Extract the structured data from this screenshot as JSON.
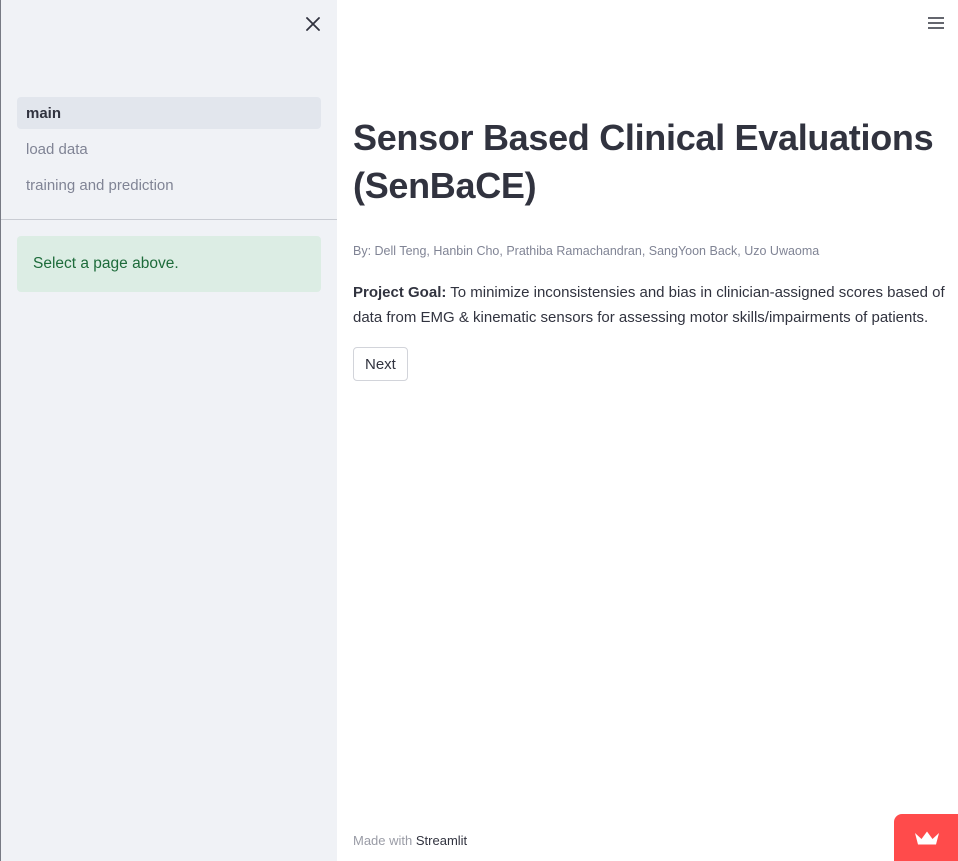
{
  "sidebar": {
    "close_icon": "close-icon",
    "nav_items": [
      {
        "label": "main",
        "active": true
      },
      {
        "label": "load data",
        "active": false
      },
      {
        "label": "training and prediction",
        "active": false
      }
    ],
    "info_message": "Select a page above."
  },
  "header": {
    "menu_icon": "hamburger-menu-icon"
  },
  "main": {
    "title": "Sensor Based Clinical Evaluations (SenBaCE)",
    "byline": "By: Dell Teng, Hanbin Cho, Prathiba Ramachandran, SangYoon Back, Uzo Uwaoma",
    "goal_label": "Project Goal:",
    "goal_text": " To minimize inconsistensies and bias in clinician-assigned scores based of data from EMG & kinematic sensors for assessing motor skills/impairments of patients.",
    "next_button": "Next"
  },
  "footer": {
    "made_with": "Made with ",
    "link_text": "Streamlit"
  },
  "badge": {
    "icon": "crown-icon"
  },
  "colors": {
    "sidebar_bg": "#f0f2f6",
    "active_nav_bg": "#e2e6ed",
    "info_bg": "#dcede4",
    "info_text": "#1d6b3a",
    "accent": "#ff4b4b"
  }
}
